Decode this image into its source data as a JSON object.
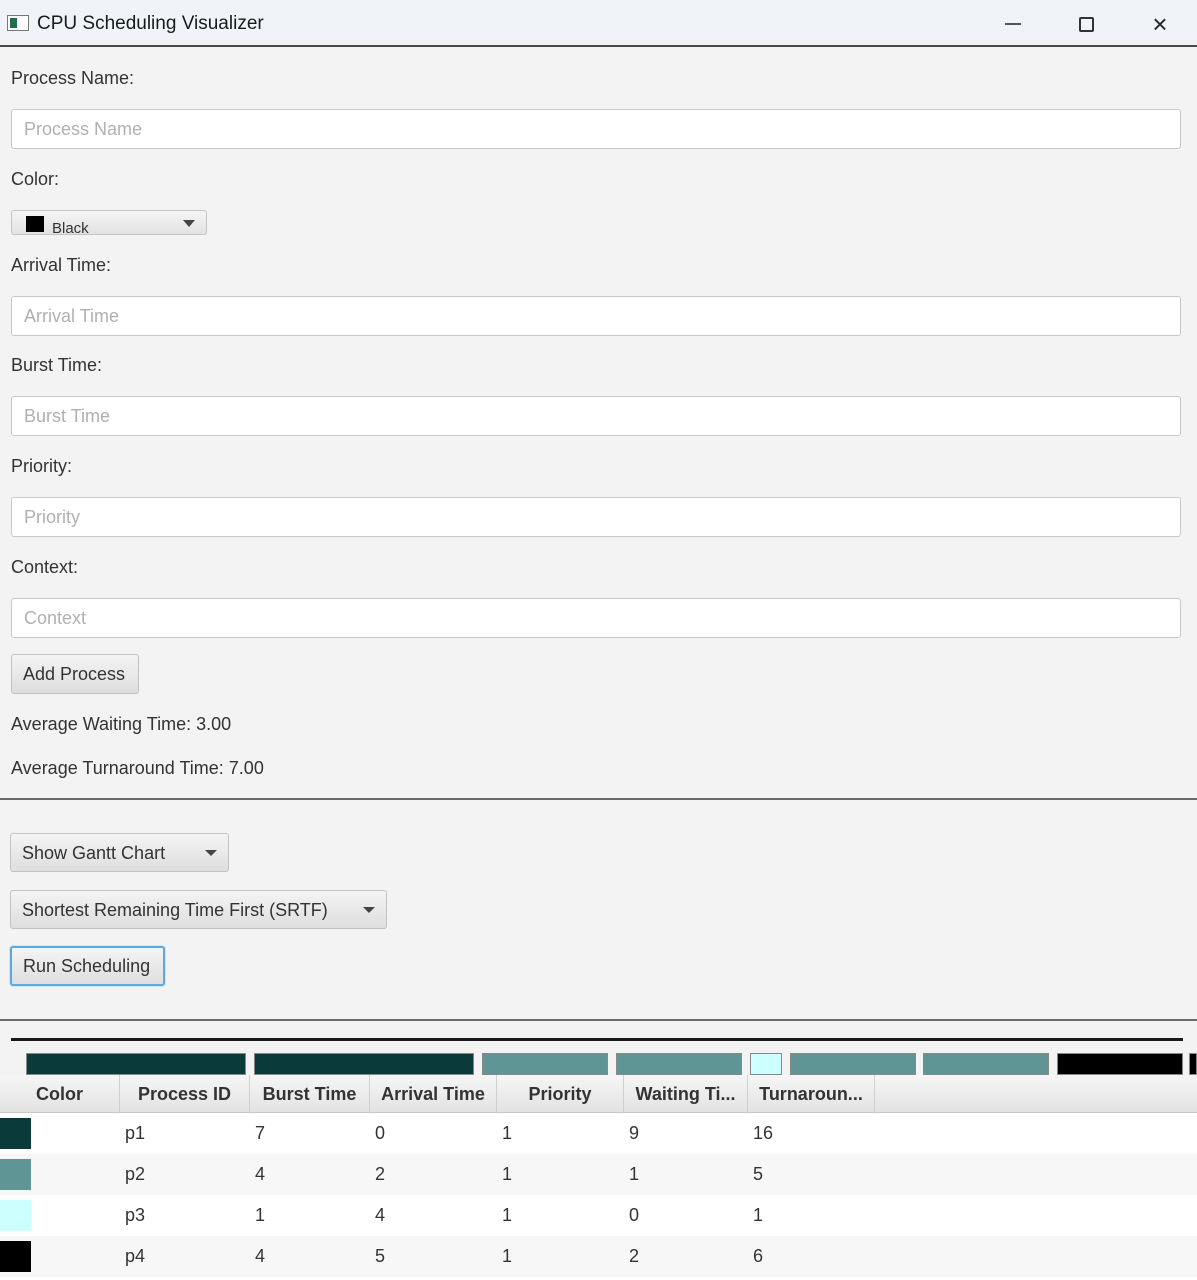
{
  "window": {
    "title": "CPU Scheduling Visualizer",
    "min_icon": "minimize-icon",
    "max_icon": "maximize-icon",
    "close_icon": "close-icon",
    "close_glyph": "×"
  },
  "form": {
    "process_name_label": "Process Name:",
    "process_name_placeholder": "Process Name",
    "color_label": "Color:",
    "color_value": "Black",
    "color_swatch": "#000000",
    "arrival_label": "Arrival Time:",
    "arrival_placeholder": "Arrival Time",
    "burst_label": "Burst Time:",
    "burst_placeholder": "Burst Time",
    "priority_label": "Priority:",
    "priority_placeholder": "Priority",
    "context_label": "Context:",
    "context_placeholder": "Context",
    "add_button": "Add Process"
  },
  "stats": {
    "avg_waiting": "Average Waiting Time: 3.00",
    "avg_turnaround": "Average Turnaround Time: 7.00"
  },
  "controls": {
    "view_select": "Show Gantt Chart",
    "algorithm_select": "Shortest Remaining Time First (SRTF)",
    "run_button": "Run Scheduling"
  },
  "gantt": {
    "blocks": [
      {
        "color": "#0a3a3a"
      },
      {
        "color": "#0a3a3a"
      },
      {
        "color": "#5f9595"
      },
      {
        "color": "#5f9595"
      },
      {
        "color": "#ccffff"
      },
      {
        "color": "#5f9595"
      },
      {
        "color": "#5f9595"
      },
      {
        "color": "#000000"
      },
      {
        "color": "#000000"
      }
    ]
  },
  "table": {
    "columns": [
      "Color",
      "Process ID",
      "Burst Time",
      "Arrival Time",
      "Priority",
      "Waiting Ti...",
      "Turnaroun..."
    ],
    "rows": [
      {
        "color": "#0a3a3a",
        "id": "p1",
        "burst": "7",
        "arrival": "0",
        "priority": "1",
        "waiting": "9",
        "turnaround": "16"
      },
      {
        "color": "#5f9595",
        "id": "p2",
        "burst": "4",
        "arrival": "2",
        "priority": "1",
        "waiting": "1",
        "turnaround": "5"
      },
      {
        "color": "#ccffff",
        "id": "p3",
        "burst": "1",
        "arrival": "4",
        "priority": "1",
        "waiting": "0",
        "turnaround": "1"
      },
      {
        "color": "#000000",
        "id": "p4",
        "burst": "4",
        "arrival": "5",
        "priority": "1",
        "waiting": "2",
        "turnaround": "6"
      }
    ]
  }
}
